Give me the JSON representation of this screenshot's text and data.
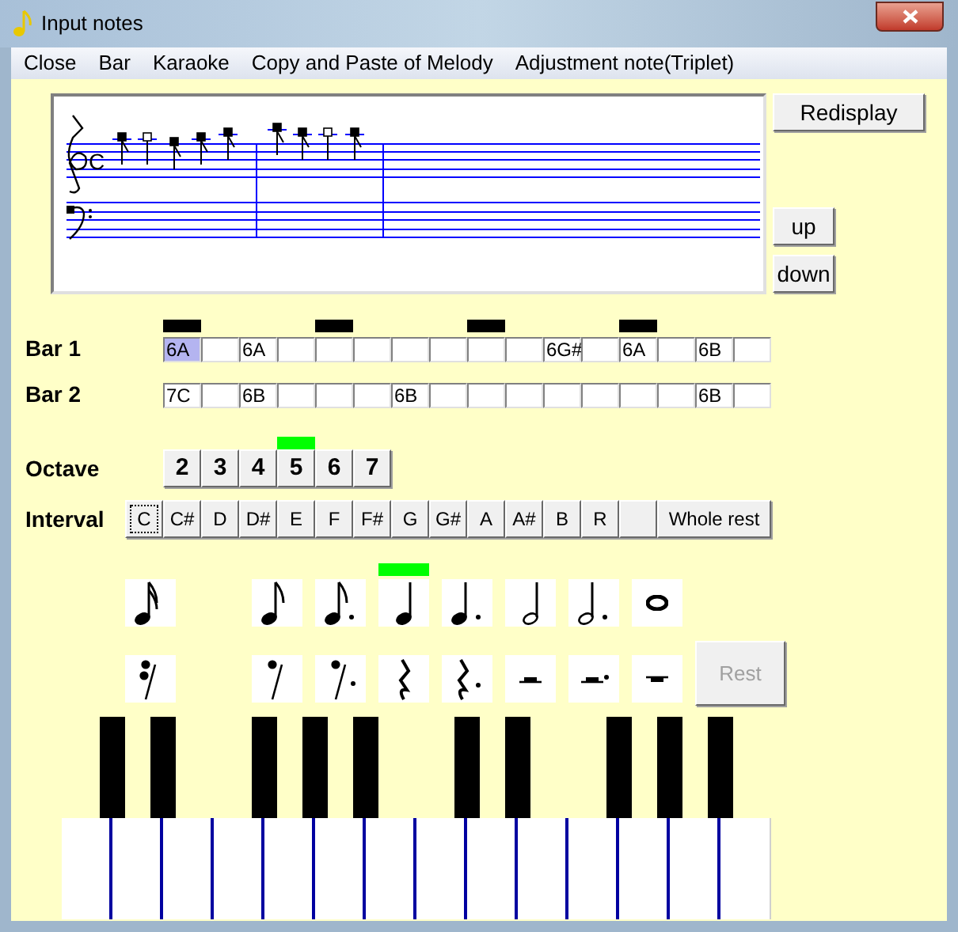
{
  "window": {
    "title": "Input notes"
  },
  "menu": [
    "Close",
    "Bar",
    "Karaoke",
    "Copy and Paste of Melody",
    "Adjustment note(Triplet)"
  ],
  "staff": {
    "time_signature": "C"
  },
  "side_buttons": [
    {
      "label": "Redisplay",
      "kind": "wide"
    },
    {
      "label": "up",
      "kind": "small"
    },
    {
      "label": "down",
      "kind": "small"
    }
  ],
  "beat_row": [
    {
      "on": true
    },
    {
      "on": false
    },
    {
      "on": false
    },
    {
      "on": false
    },
    {
      "on": true
    },
    {
      "on": false
    },
    {
      "on": false
    },
    {
      "on": false
    },
    {
      "on": true
    },
    {
      "on": false
    },
    {
      "on": false
    },
    {
      "on": false
    },
    {
      "on": true
    },
    {
      "on": false
    },
    {
      "on": false
    },
    {
      "on": false
    }
  ],
  "bars": [
    {
      "label": "Bar 1",
      "cells": [
        {
          "note": "6A",
          "selected": true
        },
        {
          "selected": false
        },
        {
          "note": "6A",
          "selected": false
        },
        {
          "selected": false
        },
        {
          "selected": false
        },
        {
          "selected": false
        },
        {
          "selected": false
        },
        {
          "selected": false
        },
        {
          "selected": false
        },
        {
          "selected": false
        },
        {
          "note": "6G#",
          "selected": false
        },
        {
          "selected": false
        },
        {
          "note": "6A",
          "selected": false
        },
        {
          "selected": false
        },
        {
          "note": "6B",
          "selected": false
        },
        {
          "selected": false
        }
      ]
    },
    {
      "label": "Bar 2",
      "cells": [
        {
          "note": "7C",
          "selected": false
        },
        {
          "selected": false
        },
        {
          "note": "6B",
          "selected": false
        },
        {
          "selected": false
        },
        {
          "selected": false
        },
        {
          "selected": false
        },
        {
          "note": "6B",
          "selected": false
        },
        {
          "selected": false
        },
        {
          "selected": false
        },
        {
          "selected": false
        },
        {
          "selected": false
        },
        {
          "selected": false
        },
        {
          "selected": false
        },
        {
          "selected": false
        },
        {
          "note": "6B",
          "selected": false
        },
        {
          "selected": false
        }
      ]
    }
  ],
  "octave": {
    "label": "Octave",
    "options": [
      {
        "label": "2",
        "selected": false
      },
      {
        "label": "3",
        "selected": false
      },
      {
        "label": "4",
        "selected": false
      },
      {
        "label": "5",
        "selected": true
      },
      {
        "label": "6",
        "selected": false
      },
      {
        "label": "7",
        "selected": false
      }
    ]
  },
  "interval": {
    "label": "Interval",
    "options": [
      {
        "kind": "note",
        "label": "C",
        "focused": true
      },
      {
        "kind": "note",
        "label": "C#",
        "focused": false
      },
      {
        "kind": "note",
        "label": "D",
        "focused": false
      },
      {
        "kind": "note",
        "label": "D#",
        "focused": false
      },
      {
        "kind": "note",
        "label": "E",
        "focused": false
      },
      {
        "kind": "note",
        "label": "F",
        "focused": false
      },
      {
        "kind": "note",
        "label": "F#",
        "focused": false
      },
      {
        "kind": "note",
        "label": "G",
        "focused": false
      },
      {
        "kind": "note",
        "label": "G#",
        "focused": false
      },
      {
        "kind": "note",
        "label": "A",
        "focused": false
      },
      {
        "kind": "note",
        "label": "A#",
        "focused": false
      },
      {
        "kind": "note",
        "label": "B",
        "focused": false
      },
      {
        "kind": "note",
        "label": "R",
        "focused": false
      },
      {
        "kind": "blank",
        "focused": false
      },
      {
        "kind": "wide",
        "label": "Whole rest",
        "focused": false
      }
    ]
  },
  "note_values": [
    {
      "kind": "sixteenth",
      "selected": false
    },
    {
      "kind": "gap",
      "selected": false
    },
    {
      "kind": "eighth",
      "selected": false
    },
    {
      "kind": "dotted-eighth",
      "selected": false
    },
    {
      "kind": "quarter",
      "selected": true
    },
    {
      "kind": "dotted-quarter",
      "selected": false
    },
    {
      "kind": "half",
      "selected": false
    },
    {
      "kind": "dotted-half",
      "selected": false
    },
    {
      "kind": "whole",
      "selected": false
    }
  ],
  "rest_values": [
    {
      "kind": "sixteenth"
    },
    {
      "kind": "gap"
    },
    {
      "kind": "eighth"
    },
    {
      "kind": "dotted-eighth"
    },
    {
      "kind": "quarter"
    },
    {
      "kind": "dotted-quarter"
    },
    {
      "kind": "half"
    },
    {
      "kind": "dotted-half"
    },
    {
      "kind": "whole"
    }
  ],
  "rest_button": {
    "label": "Rest",
    "disabled": true
  }
}
